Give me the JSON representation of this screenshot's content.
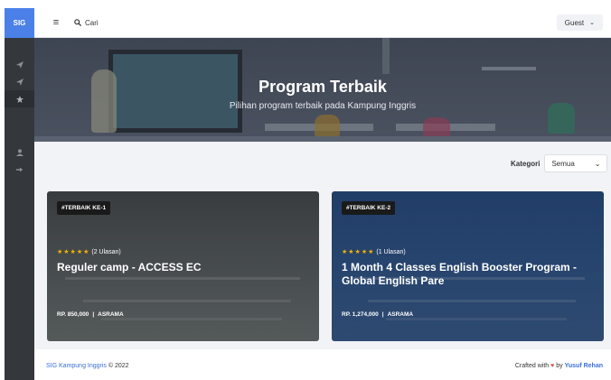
{
  "sidebar": {
    "brand": "SIG",
    "icons": [
      "paper-plane-icon",
      "paper-plane-icon",
      "star-icon",
      "user-icon",
      "sign-in-icon"
    ]
  },
  "topbar": {
    "menu_icon": "≡",
    "search_icon": "⌕",
    "search_label": "Cari",
    "user_label": "Guest",
    "user_chevron": "⌄"
  },
  "hero": {
    "title": "Program Terbaik",
    "subtitle": "Pilihan program terbaik pada Kampung Inggris"
  },
  "filter": {
    "label": "Kategori",
    "selected": "Semua",
    "chevron": "⌄"
  },
  "cards": [
    {
      "badge": "#TERBAIK KE-1",
      "stars": "★★★★★",
      "reviews": "(2 Ulasan)",
      "title": "Reguler camp - ACCESS EC",
      "price": "RP. 850,000",
      "type": "ASRAMA"
    },
    {
      "badge": "#TERBAIK KE-2",
      "stars": "★★★★★",
      "reviews": "(1 Ulasan)",
      "title": "1 Month 4 Classes English Booster Program - Global English Pare",
      "price": "RP. 1,274,000",
      "type": "ASRAMA"
    }
  ],
  "footer": {
    "brand": "SIG Kampung Inggris",
    "copyright": "© 2022",
    "crafted": "Crafted with",
    "heart": "♥",
    "by": "by",
    "author": "Yusuf Rehan"
  },
  "colors": {
    "brand": "#4a80e8",
    "sidebar": "#34383d",
    "star": "#f5b301",
    "link": "#3a6fd8",
    "heart": "#e74c3c"
  }
}
